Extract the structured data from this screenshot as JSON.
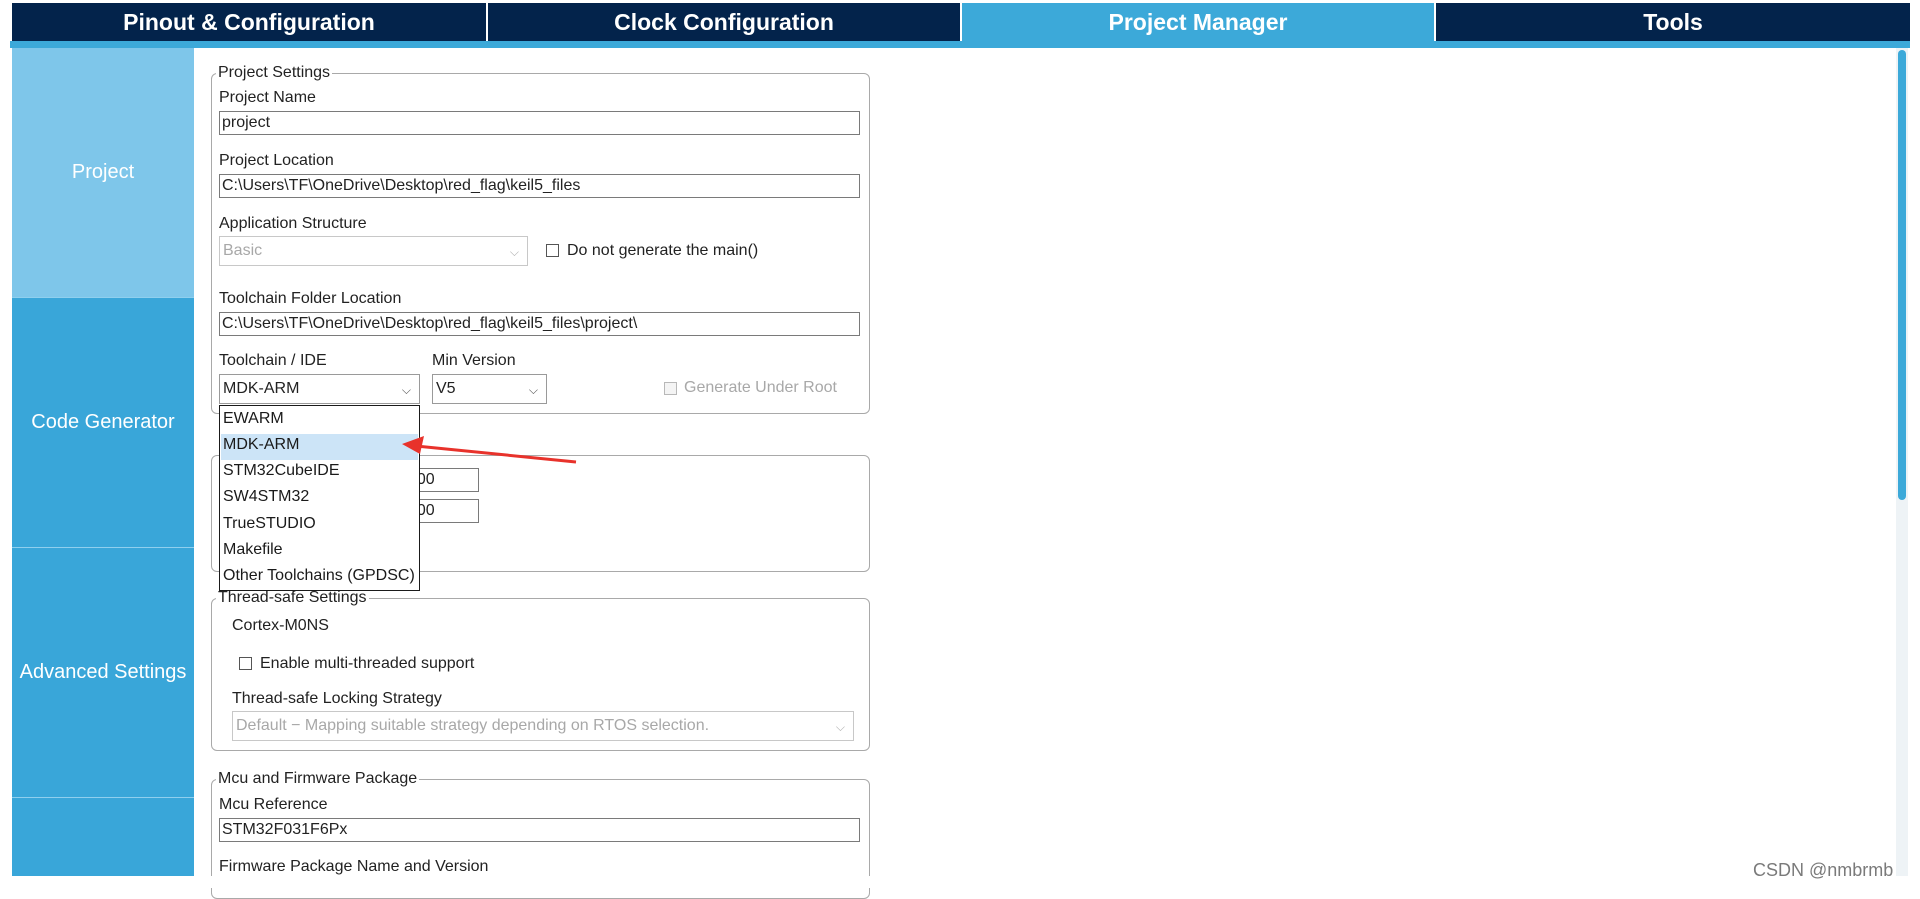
{
  "tabs": [
    {
      "label": "Pinout & Configuration"
    },
    {
      "label": "Clock Configuration"
    },
    {
      "label": "Project Manager"
    },
    {
      "label": "Tools"
    }
  ],
  "sidebar": {
    "items": [
      {
        "label": "Project"
      },
      {
        "label": "Code Generator"
      },
      {
        "label": "Advanced Settings"
      }
    ]
  },
  "project_settings": {
    "legend": "Project Settings",
    "project_name_label": "Project Name",
    "project_name_value": "project",
    "project_location_label": "Project Location",
    "project_location_value": "C:\\Users\\TF\\OneDrive\\Desktop\\red_flag\\keil5_files",
    "app_structure_label": "Application Structure",
    "app_structure_value": "Basic",
    "no_main_label": "Do not generate the main()",
    "toolchain_folder_label": "Toolchain Folder Location",
    "toolchain_folder_value": "C:\\Users\\TF\\OneDrive\\Desktop\\red_flag\\keil5_files\\project\\",
    "toolchain_label": "Toolchain / IDE",
    "toolchain_value": "MDK-ARM",
    "min_version_label": "Min Version",
    "min_version_value": "V5",
    "gen_under_root_label": "Generate Under Root"
  },
  "linker": {
    "heap_value_partial": "200",
    "stack_value_partial": "400"
  },
  "toolchain_dropdown": {
    "options": [
      "EWARM",
      "MDK-ARM",
      "STM32CubeIDE",
      "SW4STM32",
      "TrueSTUDIO",
      "Makefile",
      "Other Toolchains (GPDSC)"
    ],
    "selected": "MDK-ARM"
  },
  "thread_safe": {
    "legend": "Thread-safe Settings",
    "core_label": "Cortex-M0NS",
    "multithread_label": "Enable multi-threaded support",
    "strategy_label": "Thread-safe Locking Strategy",
    "strategy_value": "Default  −  Mapping suitable strategy depending on RTOS selection."
  },
  "mcu_firmware": {
    "legend": "Mcu and Firmware Package",
    "mcu_ref_label": "Mcu Reference",
    "mcu_ref_value": "STM32F031F6Px",
    "fw_pkg_label": "Firmware Package Name and Version"
  },
  "watermark": "CSDN @nmbrmb",
  "colors": {
    "tab_dark": "#03234b",
    "tab_active": "#3ca9d9",
    "sidebar": "#39a6d9",
    "sidebar_active": "#7ec6ea",
    "annotation_arrow": "#e8322b"
  }
}
